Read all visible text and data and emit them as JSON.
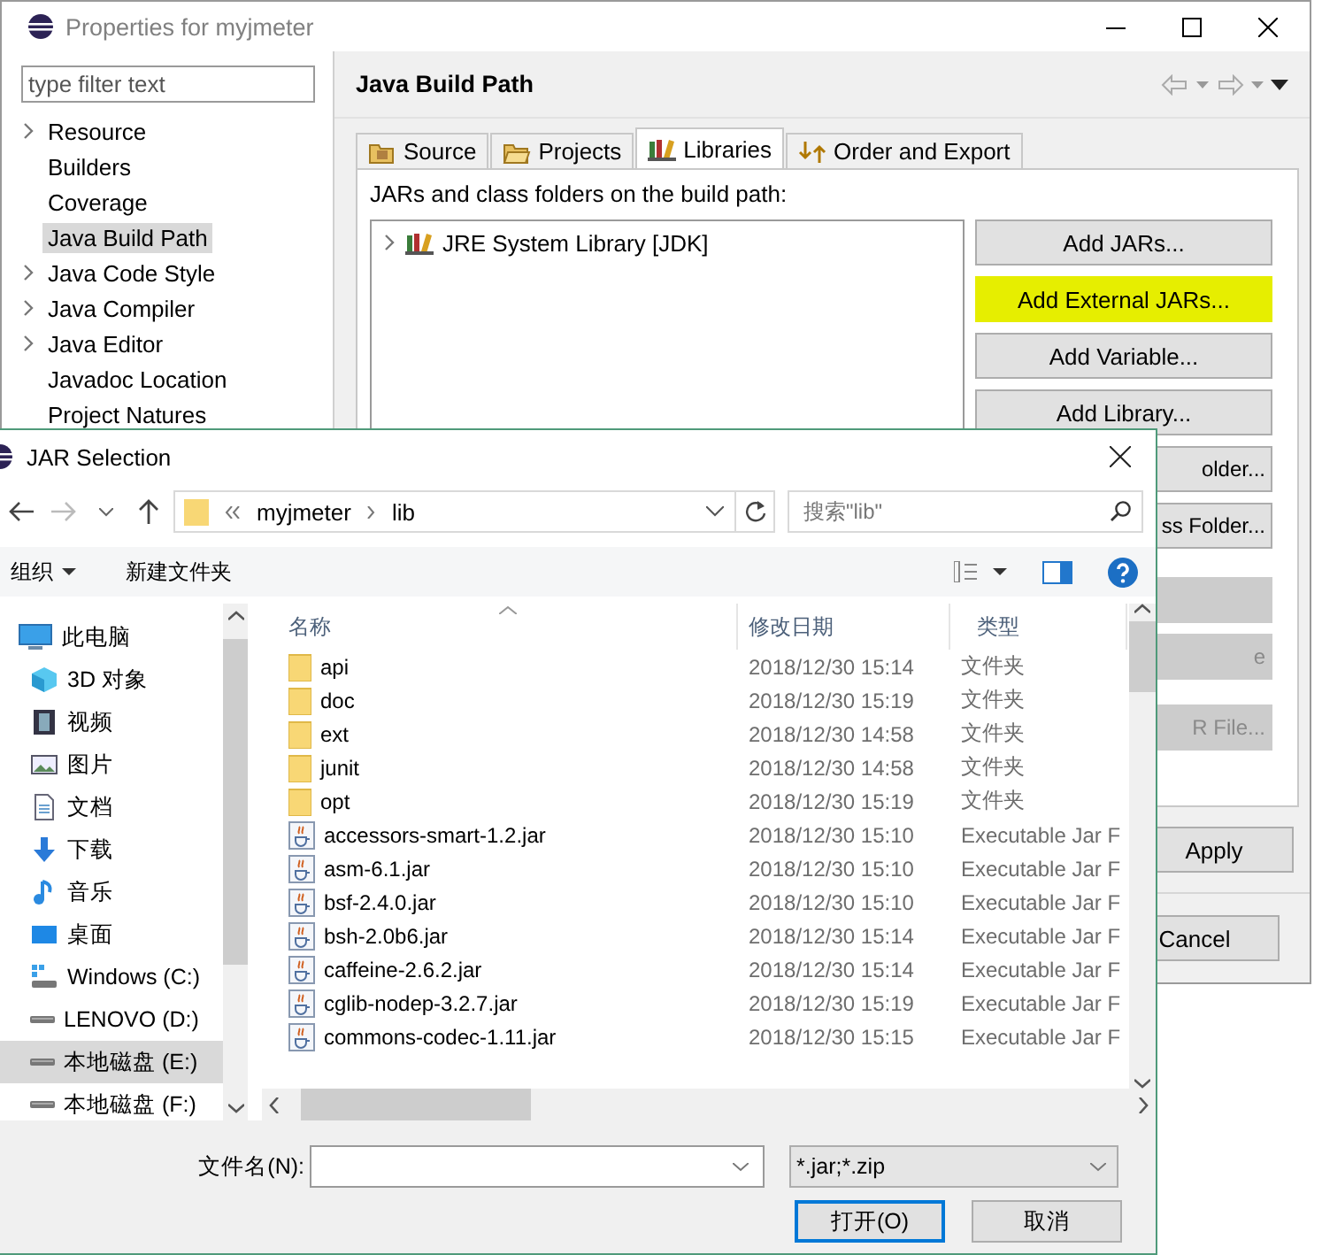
{
  "properties_window": {
    "title": "Properties for myjmeter",
    "filter": {
      "placeholder": "type filter text"
    },
    "sidebar": {
      "items": [
        {
          "label": "Resource",
          "expandable": true,
          "selected": false
        },
        {
          "label": "Builders",
          "expandable": false,
          "selected": false
        },
        {
          "label": "Coverage",
          "expandable": false,
          "selected": false
        },
        {
          "label": "Java Build Path",
          "expandable": false,
          "selected": true
        },
        {
          "label": "Java Code Style",
          "expandable": true,
          "selected": false
        },
        {
          "label": "Java Compiler",
          "expandable": true,
          "selected": false
        },
        {
          "label": "Java Editor",
          "expandable": true,
          "selected": false
        },
        {
          "label": "Javadoc Location",
          "expandable": false,
          "selected": false
        },
        {
          "label": "Project Natures",
          "expandable": false,
          "selected": false
        }
      ]
    },
    "page_title": "Java Build Path",
    "tabs": [
      {
        "label": "Source",
        "kind": "source",
        "selected": false
      },
      {
        "label": "Projects",
        "kind": "projects",
        "selected": false
      },
      {
        "label": "Libraries",
        "kind": "libraries",
        "selected": true
      },
      {
        "label": "Order and Export",
        "kind": "order",
        "selected": false
      }
    ],
    "list_label": "JARs and class folders on the build path:",
    "tree": [
      {
        "label": "JRE System Library [JDK]",
        "expanded": false
      }
    ],
    "buttons": [
      {
        "label": "Add JARs...",
        "kind": "full",
        "highlighted": false,
        "disabled": false
      },
      {
        "label": "Add External JARs...",
        "kind": "full",
        "highlighted": true,
        "disabled": false
      },
      {
        "label": "Add Variable...",
        "kind": "full",
        "highlighted": false,
        "disabled": false
      },
      {
        "label": "Add Library...",
        "kind": "full",
        "highlighted": false,
        "disabled": false
      },
      {
        "label": "older...",
        "kind": "covered",
        "highlighted": false,
        "disabled": false
      },
      {
        "label": "ss Folder...",
        "kind": "covered",
        "highlighted": false,
        "disabled": false
      },
      {
        "kind": "covered",
        "highlighted": false,
        "disabled": true
      },
      {
        "label": "e",
        "kind": "covered",
        "highlighted": false,
        "disabled": true
      },
      {
        "label": "R File...",
        "kind": "covered",
        "highlighted": false,
        "disabled": true
      }
    ],
    "apply_button": "Apply",
    "cancel_button": "Cancel"
  },
  "jar_dialog": {
    "title": "JAR Selection",
    "address": {
      "crumbs": [
        "myjmeter",
        "lib"
      ]
    },
    "search": {
      "placeholder": "搜索\"lib\""
    },
    "toolbar": {
      "organize": "组织",
      "new_folder": "新建文件夹"
    },
    "nav": {
      "items": [
        {
          "label": "此电脑",
          "kind": "pc",
          "selected": false,
          "children": [
            {
              "label": "3D 对象",
              "kind": "objects3d",
              "selected": false
            },
            {
              "label": "视频",
              "kind": "video",
              "selected": false
            },
            {
              "label": "图片",
              "kind": "pictures",
              "selected": false
            },
            {
              "label": "文档",
              "kind": "documents",
              "selected": false
            },
            {
              "label": "下载",
              "kind": "downloads",
              "selected": false
            },
            {
              "label": "音乐",
              "kind": "music",
              "selected": false
            },
            {
              "label": "桌面",
              "kind": "desktop",
              "selected": false
            },
            {
              "label": "Windows (C:)",
              "kind": "system_drive",
              "selected": false
            },
            {
              "label": "LENOVO (D:)",
              "kind": "drive",
              "selected": false
            },
            {
              "label": "本地磁盘 (E:)",
              "kind": "drive",
              "selected": true
            },
            {
              "label": "本地磁盘 (F:)",
              "kind": "drive",
              "selected": false
            }
          ]
        }
      ]
    },
    "table": {
      "columns": [
        "名称",
        "修改日期",
        "类型"
      ],
      "rows": [
        {
          "kind": "folder",
          "name": "api",
          "modified": "2018/12/30 15:14",
          "type": "文件夹"
        },
        {
          "kind": "folder",
          "name": "doc",
          "modified": "2018/12/30 15:19",
          "type": "文件夹"
        },
        {
          "kind": "folder",
          "name": "ext",
          "modified": "2018/12/30 14:58",
          "type": "文件夹"
        },
        {
          "kind": "folder",
          "name": "junit",
          "modified": "2018/12/30 14:58",
          "type": "文件夹"
        },
        {
          "kind": "folder",
          "name": "opt",
          "modified": "2018/12/30 15:19",
          "type": "文件夹"
        },
        {
          "kind": "jar",
          "name": "accessors-smart-1.2.jar",
          "modified": "2018/12/30 15:10",
          "type": "Executable Jar F"
        },
        {
          "kind": "jar",
          "name": "asm-6.1.jar",
          "modified": "2018/12/30 15:10",
          "type": "Executable Jar F"
        },
        {
          "kind": "jar",
          "name": "bsf-2.4.0.jar",
          "modified": "2018/12/30 15:10",
          "type": "Executable Jar F"
        },
        {
          "kind": "jar",
          "name": "bsh-2.0b6.jar",
          "modified": "2018/12/30 15:14",
          "type": "Executable Jar F"
        },
        {
          "kind": "jar",
          "name": "caffeine-2.6.2.jar",
          "modified": "2018/12/30 15:14",
          "type": "Executable Jar F"
        },
        {
          "kind": "jar",
          "name": "cglib-nodep-3.2.7.jar",
          "modified": "2018/12/30 15:19",
          "type": "Executable Jar F"
        },
        {
          "kind": "jar",
          "name": "commons-codec-1.11.jar",
          "modified": "2018/12/30 15:15",
          "type": "Executable Jar F"
        }
      ]
    },
    "file_name": {
      "label": "文件名(N):"
    },
    "file_type": "*.jar;*.zip",
    "buttons": [
      {
        "label": "打开(O)",
        "default": true
      },
      {
        "label": "取消",
        "default": false
      }
    ]
  }
}
